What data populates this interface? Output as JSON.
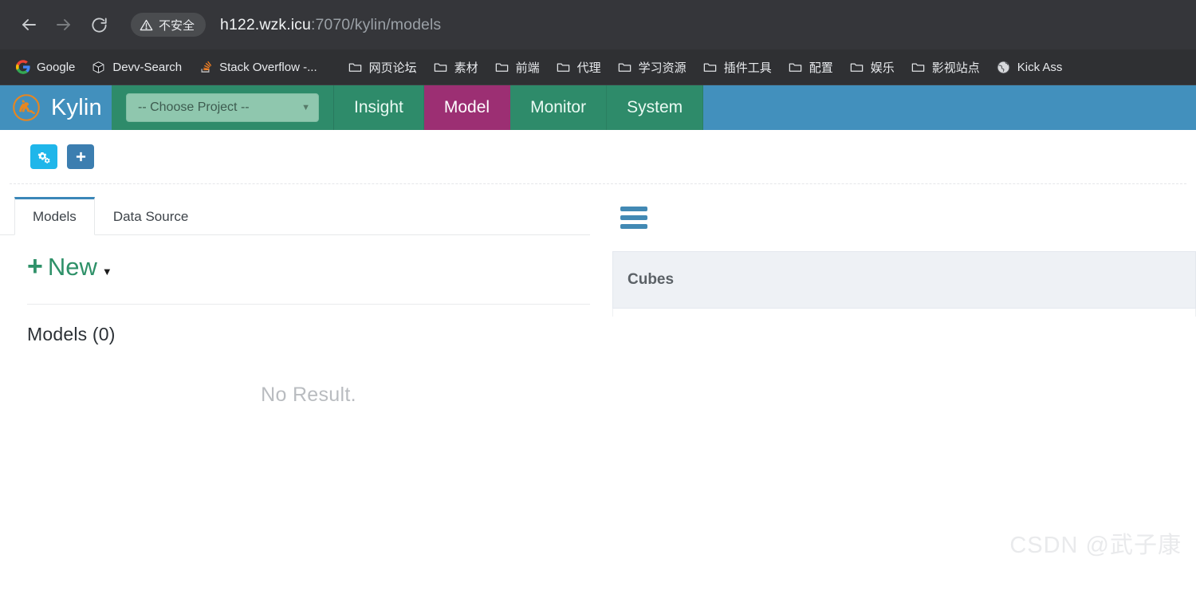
{
  "browser": {
    "back_label": "Back",
    "forward_label": "Forward",
    "reload_label": "Reload",
    "security_badge": "不安全",
    "url_host": "h122.wzk.icu",
    "url_rest": ":7070/kylin/models",
    "bookmarks": [
      {
        "label": "Google",
        "icon": "google-icon"
      },
      {
        "label": "Devv-Search",
        "icon": "cube-icon"
      },
      {
        "label": "Stack Overflow -...",
        "icon": "stackoverflow-icon"
      },
      {
        "label": "网页论坛",
        "icon": "folder-icon"
      },
      {
        "label": "素材",
        "icon": "folder-icon"
      },
      {
        "label": "前端",
        "icon": "folder-icon"
      },
      {
        "label": "代理",
        "icon": "folder-icon"
      },
      {
        "label": "学习资源",
        "icon": "folder-icon"
      },
      {
        "label": "插件工具",
        "icon": "folder-icon"
      },
      {
        "label": "配置",
        "icon": "folder-icon"
      },
      {
        "label": "娱乐",
        "icon": "folder-icon"
      },
      {
        "label": "影视站点",
        "icon": "folder-icon"
      },
      {
        "label": "Kick Ass",
        "icon": "globe-icon"
      }
    ]
  },
  "app": {
    "brand_name": "Kylin",
    "brand_logo_icon": "kylin-logo-icon",
    "project_selector": {
      "value": "-- Choose Project --",
      "caret_icon": "chevron-down-icon"
    },
    "nav_tabs": [
      {
        "label": "Insight",
        "active": false
      },
      {
        "label": "Model",
        "active": true
      },
      {
        "label": "Monitor",
        "active": false
      },
      {
        "label": "System",
        "active": false
      }
    ],
    "colors": {
      "brand_blue": "#4290bd",
      "nav_green": "#2e8b6a",
      "active_tab_magenta": "#9c2f73",
      "accent_cyan": "#1fb6ea",
      "accent_blue": "#3c7eb0",
      "link_green": "#2f9169",
      "tab_underline_blue": "#3b87b8"
    }
  },
  "toolbar": {
    "buttons": [
      {
        "name": "cogs-button",
        "icon": "cogs-icon",
        "style": "cyan"
      },
      {
        "name": "add-button",
        "icon": "plus-icon",
        "style": "blue"
      }
    ]
  },
  "left_panel": {
    "tabs": [
      {
        "label": "Models",
        "active": true
      },
      {
        "label": "Data Source",
        "active": false
      }
    ],
    "new_button": {
      "plus": "+",
      "label": "New",
      "caret_icon": "caret-down-icon"
    },
    "models_count_label": "Models (0)",
    "empty_state": "No Result."
  },
  "right_panel": {
    "menu_icon": "hamburger-menu-icon",
    "cubes_title": "Cubes"
  },
  "watermark": "CSDN @武子康"
}
